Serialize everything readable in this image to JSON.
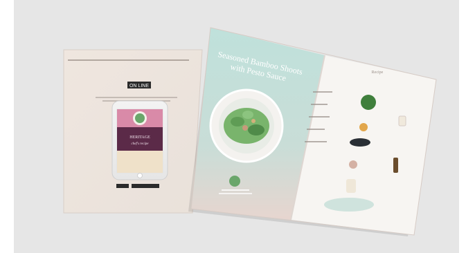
{
  "scene": {
    "background_color": "#e6e6e6",
    "back_brochure": {
      "online_label": "ON LINE",
      "phone_title_line1": "HERITAGE",
      "phone_title_line2": "chef's recipe"
    },
    "front_brochure": {
      "title_line1": "Seasoned Bamboo Shoots",
      "title_line2": "with Pesto Sauce",
      "right_page_header": "Recipe"
    }
  },
  "colors": {
    "mint": "#b6d9d2",
    "blush": "#e7d5cf",
    "plum": "#5b2a48",
    "pink": "#d98aa8",
    "paper": "#f7f5f2"
  }
}
